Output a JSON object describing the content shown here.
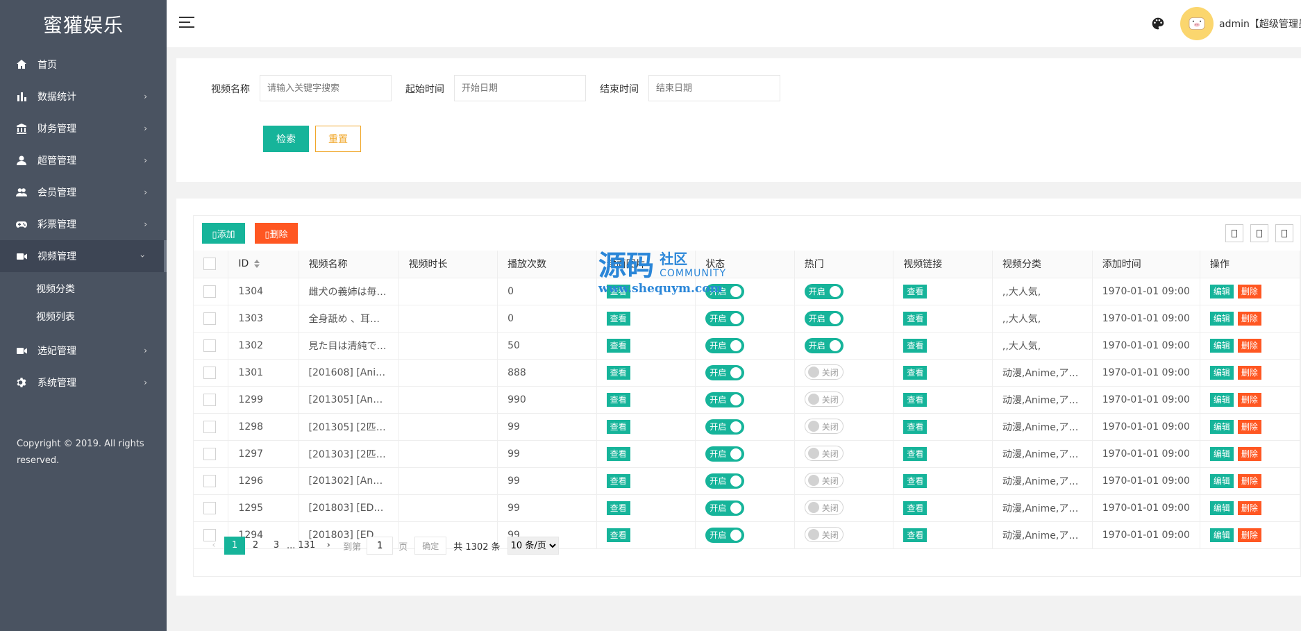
{
  "app": {
    "title": "蜜獾娱乐"
  },
  "sidebar": {
    "items": [
      {
        "label": "首页",
        "icon": "home-icon",
        "arrow": ""
      },
      {
        "label": "数据统计",
        "icon": "bar-chart-icon",
        "arrow": "›"
      },
      {
        "label": "财务管理",
        "icon": "bank-icon",
        "arrow": "›"
      },
      {
        "label": "超管管理",
        "icon": "user-icon",
        "arrow": "›"
      },
      {
        "label": "会员管理",
        "icon": "users-icon",
        "arrow": "›"
      },
      {
        "label": "彩票管理",
        "icon": "gamepad-icon",
        "arrow": "›"
      },
      {
        "label": "视频管理",
        "icon": "video-icon",
        "arrow": "›"
      }
    ],
    "subitems": [
      {
        "label": "视频分类"
      },
      {
        "label": "视频列表"
      }
    ],
    "items_after": [
      {
        "label": "选妃管理",
        "icon": "video-icon",
        "arrow": "›"
      },
      {
        "label": "系统管理",
        "icon": "gear-icon",
        "arrow": "›"
      }
    ],
    "copyright": "Copyright © 2019. All rights reserved."
  },
  "topbar": {
    "admin_name": "admin【超级管理员】"
  },
  "search": {
    "name_label": "视频名称",
    "name_placeholder": "请输入关键字搜索",
    "start_label": "起始时间",
    "start_placeholder": "开始日期",
    "end_label": "结束时间",
    "end_placeholder": "结束日期",
    "search_button": "检索",
    "reset_button": "重置"
  },
  "toolbar": {
    "add_label": "添加",
    "delete_label": "删除"
  },
  "table": {
    "headers": {
      "id": "ID",
      "name": "视频名称",
      "duration": "视频时长",
      "plays": "播放次数",
      "cover": "封面图片",
      "status": "状态",
      "hot": "热门",
      "link": "视频链接",
      "category": "视频分类",
      "added": "添加时间",
      "ops": "操作"
    },
    "view_label": "查看",
    "on_label": "开启",
    "off_label": "关闭",
    "edit_label": "编辑",
    "delete_label": "删除",
    "rows": [
      {
        "id": "1304",
        "name": "雌犬の義姉は毎…",
        "duration": "",
        "plays": "0",
        "status": "on",
        "hot": "on",
        "category": ",,大人気,",
        "added": "1970-01-01 09:00"
      },
      {
        "id": "1303",
        "name": "全身舐め 、耳…",
        "duration": "",
        "plays": "0",
        "status": "on",
        "hot": "on",
        "category": ",,大人気,",
        "added": "1970-01-01 09:00"
      },
      {
        "id": "1302",
        "name": "見た目は清純で…",
        "duration": "",
        "plays": "50",
        "status": "on",
        "hot": "on",
        "category": ",,大人気,",
        "added": "1970-01-01 09:00"
      },
      {
        "id": "1301",
        "name": "[201608] [AniM…",
        "duration": "",
        "plays": "888",
        "status": "on",
        "hot": "off",
        "category": "动漫,Anime,ア…",
        "added": "1970-01-01 09:00"
      },
      {
        "id": "1299",
        "name": "[201305] [AnDe…",
        "duration": "",
        "plays": "990",
        "status": "on",
        "hot": "off",
        "category": "动漫,Anime,ア…",
        "added": "1970-01-01 09:00"
      },
      {
        "id": "1298",
        "name": "[201305] [2匹目…",
        "duration": "",
        "plays": "99",
        "status": "on",
        "hot": "off",
        "category": "动漫,Anime,ア…",
        "added": "1970-01-01 09:00"
      },
      {
        "id": "1297",
        "name": "[201303] [2匹目…",
        "duration": "",
        "plays": "99",
        "status": "on",
        "hot": "off",
        "category": "动漫,Anime,ア…",
        "added": "1970-01-01 09:00"
      },
      {
        "id": "1296",
        "name": "[201302] [AnDe…",
        "duration": "",
        "plays": "99",
        "status": "on",
        "hot": "off",
        "category": "动漫,Anime,ア…",
        "added": "1970-01-01 09:00"
      },
      {
        "id": "1295",
        "name": "[201803] [EDG…",
        "duration": "",
        "plays": "99",
        "status": "on",
        "hot": "off",
        "category": "动漫,Anime,ア…",
        "added": "1970-01-01 09:00"
      },
      {
        "id": "1294",
        "name": "[201803] [EDG…",
        "duration": "",
        "plays": "99",
        "status": "on",
        "hot": "off",
        "category": "动漫,Anime,ア…",
        "added": "1970-01-01 09:00"
      }
    ]
  },
  "pagination": {
    "prev": "‹",
    "pages": [
      "1",
      "2",
      "3"
    ],
    "ellipsis": "...",
    "last": "131",
    "next": "›",
    "goto_label": "到第",
    "goto_value": "1",
    "page_unit": "页",
    "confirm": "确定",
    "total": "共 1302 条",
    "page_size": "10 条/页"
  },
  "watermark": {
    "big": "源码",
    "cn": "社区",
    "en": "COMMUNITY",
    "url": "www.shequym.com"
  },
  "colors": {
    "sidebar": "#4a5361",
    "primary": "#16b49a",
    "danger": "#ff5722",
    "warning": "#f0a72a"
  }
}
